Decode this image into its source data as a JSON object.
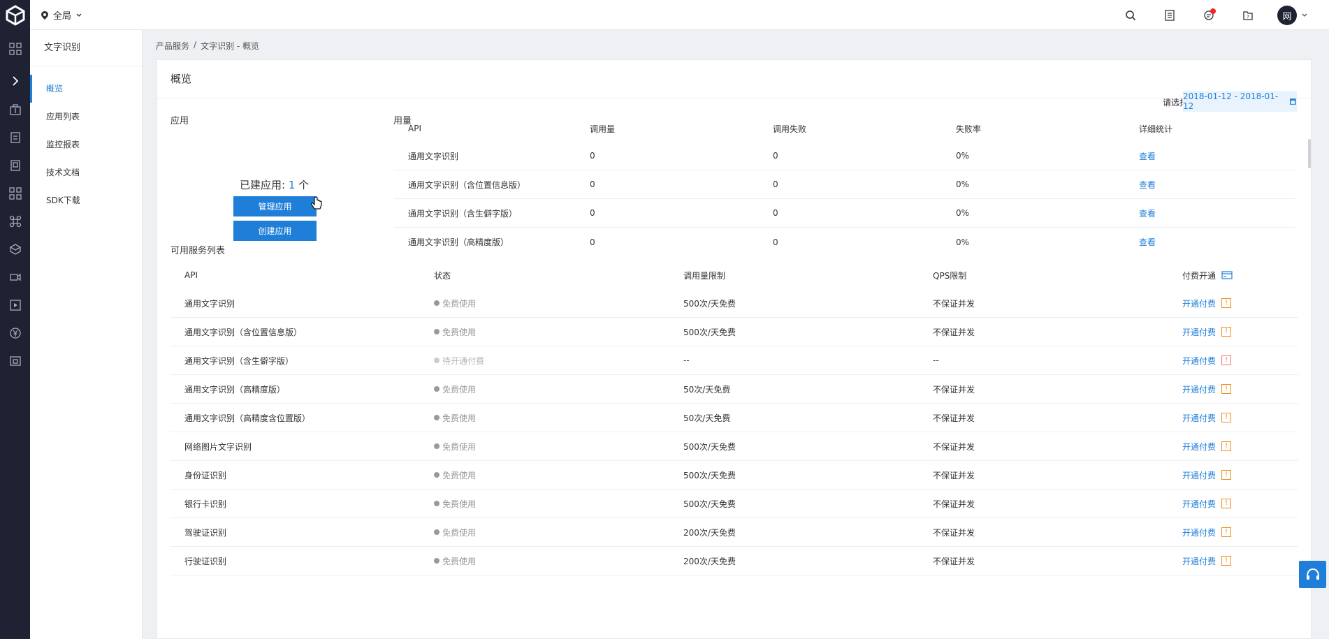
{
  "header": {
    "region": "全局",
    "avatar_initial": "网"
  },
  "subnav": {
    "title": "文字识别",
    "items": [
      {
        "label": "概览"
      },
      {
        "label": "应用列表"
      },
      {
        "label": "监控报表"
      },
      {
        "label": "技术文档"
      },
      {
        "label": "SDK下载"
      }
    ]
  },
  "breadcrumb": {
    "root": "产品服务",
    "sep": "/",
    "current": "文字识别 - 概览"
  },
  "overview": {
    "title": "概览",
    "apps_label": "应用",
    "created_prefix": "已建应用:",
    "created_count": "1",
    "created_unit": "个",
    "manage_button": "管理应用",
    "create_button": "创建应用"
  },
  "usage": {
    "label": "用量",
    "date_label": "请选择时间段",
    "date_range": "2018-01-12 - 2018-01-12",
    "columns": [
      "API",
      "调用量",
      "调用失败",
      "失败率",
      "详细统计"
    ],
    "rows": [
      {
        "api": "通用文字识别",
        "calls": "0",
        "failed": "0",
        "rate": "0%",
        "detail": "查看"
      },
      {
        "api": "通用文字识别（含位置信息版）",
        "calls": "0",
        "failed": "0",
        "rate": "0%",
        "detail": "查看"
      },
      {
        "api": "通用文字识别（含生僻字版）",
        "calls": "0",
        "failed": "0",
        "rate": "0%",
        "detail": "查看"
      },
      {
        "api": "通用文字识别（高精度版）",
        "calls": "0",
        "failed": "0",
        "rate": "0%",
        "detail": "查看"
      }
    ]
  },
  "services": {
    "label": "可用服务列表",
    "columns": [
      "API",
      "状态",
      "调用量限制",
      "QPS限制",
      "付费开通"
    ],
    "rows": [
      {
        "api": "通用文字识别",
        "status": "免费使用",
        "limit": "500次/天免费",
        "qps": "不保证并发",
        "action": "开通付费"
      },
      {
        "api": "通用文字识别（含位置信息版）",
        "status": "免费使用",
        "limit": "500次/天免费",
        "qps": "不保证并发",
        "action": "开通付费"
      },
      {
        "api": "通用文字识别（含生僻字版）",
        "status": "待开通付费",
        "limit": "--",
        "qps": "--",
        "action": "开通付费"
      },
      {
        "api": "通用文字识别（高精度版）",
        "status": "免费使用",
        "limit": "50次/天免费",
        "qps": "不保证并发",
        "action": "开通付费"
      },
      {
        "api": "通用文字识别（高精度含位置版）",
        "status": "免费使用",
        "limit": "50次/天免费",
        "qps": "不保证并发",
        "action": "开通付费"
      },
      {
        "api": "网络图片文字识别",
        "status": "免费使用",
        "limit": "500次/天免费",
        "qps": "不保证并发",
        "action": "开通付费"
      },
      {
        "api": "身份证识别",
        "status": "免费使用",
        "limit": "500次/天免费",
        "qps": "不保证并发",
        "action": "开通付费"
      },
      {
        "api": "银行卡识别",
        "status": "免费使用",
        "limit": "500次/天免费",
        "qps": "不保证并发",
        "action": "开通付费"
      },
      {
        "api": "驾驶证识别",
        "status": "免费使用",
        "limit": "200次/天免费",
        "qps": "不保证并发",
        "action": "开通付费"
      },
      {
        "api": "行驶证识别",
        "status": "免费使用",
        "limit": "200次/天免费",
        "qps": "不保证并发",
        "action": "开通付费"
      }
    ]
  },
  "colors": {
    "accent": "#1f7fd8",
    "rail": "#1e2233",
    "warn": "#f08c1a"
  },
  "icons": {
    "rail": [
      "logo-icon",
      "grid-icon",
      "chevron-right-icon",
      "building-icon",
      "document-icon",
      "book-icon",
      "apps-icon",
      "command-icon",
      "package-icon",
      "video-icon",
      "play-icon",
      "yen-icon",
      "id-card-icon"
    ],
    "top": [
      "search-icon",
      "list-icon",
      "message-icon",
      "folder-icon"
    ]
  }
}
